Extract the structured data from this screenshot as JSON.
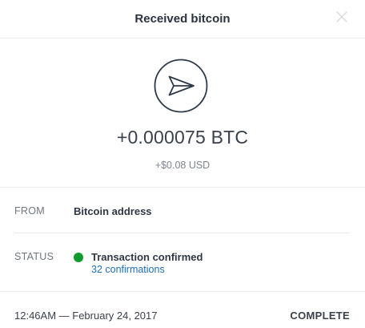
{
  "header": {
    "title": "Received bitcoin",
    "close_icon": "close-icon"
  },
  "transaction": {
    "icon": "send-arrow-icon",
    "amount": "+0.000075 BTC",
    "native_amount": "+$0.08 USD"
  },
  "details": {
    "from_label": "FROM",
    "from_value": "Bitcoin address",
    "status_label": "STATUS",
    "status_text": "Transaction confirmed",
    "status_color": "#0e9b2e",
    "confirmations": "32 confirmations",
    "link_color": "#1f6fb8"
  },
  "footer": {
    "datetime": "12:46AM — February 24, 2017",
    "status": "COMPLETE"
  }
}
